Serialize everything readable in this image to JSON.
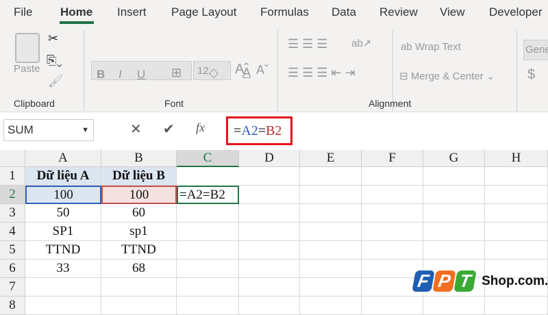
{
  "menu": {
    "tabs": [
      "File",
      "Home",
      "Insert",
      "Page Layout",
      "Formulas",
      "Data",
      "Review",
      "View",
      "Developer"
    ],
    "active": "Home",
    "accent": "#217346"
  },
  "ribbon": {
    "paste": "Paste",
    "font_size": "12",
    "wrap_text": "Wrap Text",
    "merge_center": "Merge & Center",
    "number_format": "Gene",
    "currency": "$",
    "bold": "B",
    "italic": "I",
    "underline": "U",
    "groups": {
      "clipboard": "Clipboard",
      "font": "Font",
      "alignment": "Alignment"
    }
  },
  "formula_bar": {
    "name_box": "SUM",
    "fx": "fx",
    "formula_parts": [
      "=",
      "A2",
      "=",
      "B2"
    ]
  },
  "sheet": {
    "columns": [
      "A",
      "B",
      "C",
      "D",
      "E",
      "F",
      "G",
      "H"
    ],
    "rows": [
      "1",
      "2",
      "3",
      "4",
      "5",
      "6",
      "7",
      "8"
    ],
    "cells": [
      [
        "Dữ liệu A",
        "Dữ liệu B",
        "=A2=B2"
      ],
      [
        "100",
        "100"
      ],
      [
        "50",
        "60"
      ],
      [
        "SP1",
        "sp1"
      ],
      [
        "TTND",
        "TTND"
      ],
      [
        "33",
        "68"
      ]
    ],
    "editing_cell": "=A2=B2"
  },
  "watermark": {
    "logo": "FPT",
    "text": "Shop.com.vn"
  }
}
